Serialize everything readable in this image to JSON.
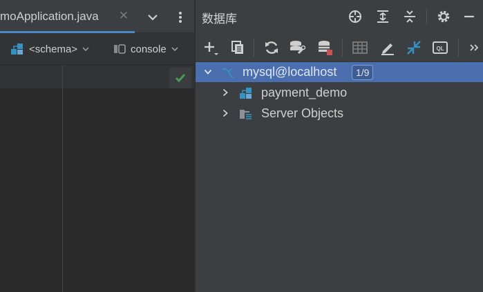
{
  "editor": {
    "tab": {
      "title": "moApplication.java",
      "close_icon": "close-icon"
    },
    "toolbar": {
      "schema_label": "<schema>",
      "console_label": "console"
    }
  },
  "database_panel": {
    "title": "数据库",
    "tree": [
      {
        "label": "mysql@localhost",
        "badge": "1/9",
        "expanded": true,
        "selected": true,
        "icon": "mysql-datasource-icon"
      },
      {
        "label": "payment_demo",
        "expanded": false,
        "selected": false,
        "icon": "schema-icon"
      },
      {
        "label": "Server Objects",
        "expanded": false,
        "selected": false,
        "icon": "server-objects-icon"
      }
    ]
  },
  "colors": {
    "panel_bg": "#3c3f41",
    "editor_bg": "#2b2b2b",
    "selection": "#4b6eaf",
    "accent_blue": "#3592c4",
    "success_green": "#499c54",
    "error_red": "#c75450"
  }
}
